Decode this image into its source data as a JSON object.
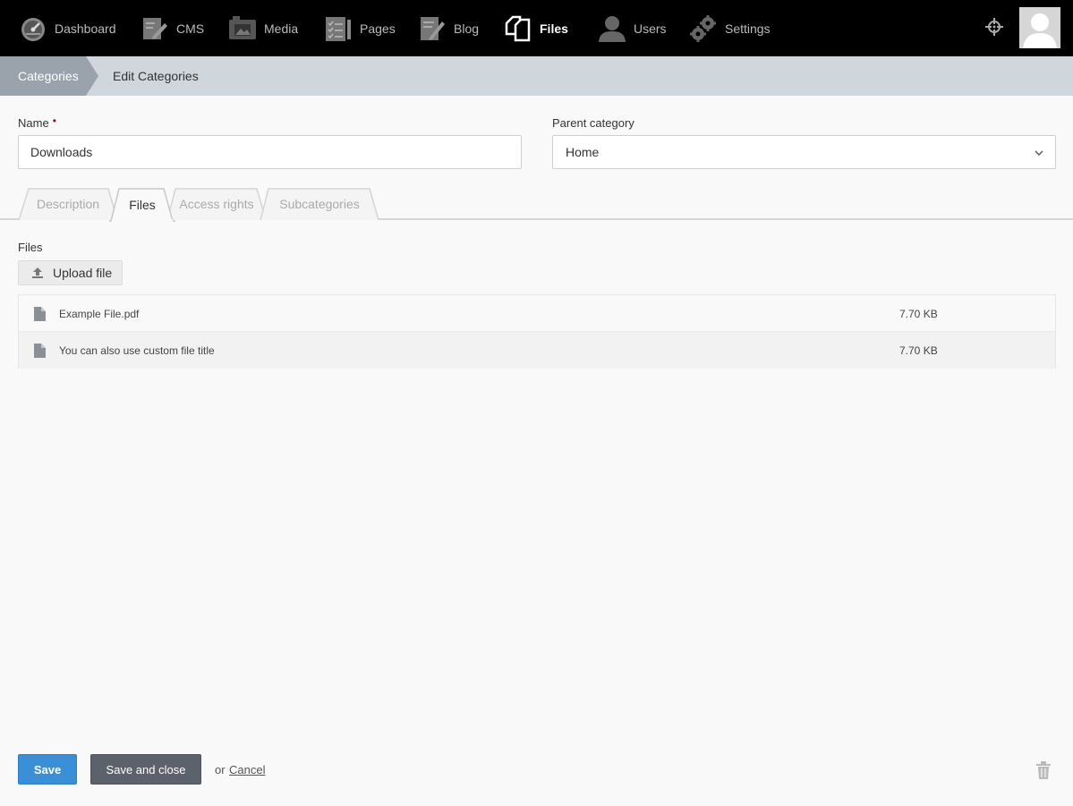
{
  "nav": {
    "items": [
      {
        "label": "Dashboard",
        "icon": "dashboard-gauge-icon"
      },
      {
        "label": "CMS",
        "icon": "cms-edit-icon"
      },
      {
        "label": "Media",
        "icon": "media-camera-icon"
      },
      {
        "label": "Pages",
        "icon": "pages-checklist-icon"
      },
      {
        "label": "Blog",
        "icon": "blog-pencil-icon"
      },
      {
        "label": "Files",
        "icon": "files-copy-icon",
        "active": true
      },
      {
        "label": "Users",
        "icon": "user-icon"
      },
      {
        "label": "Settings",
        "icon": "gears-icon"
      }
    ],
    "right_icons": [
      "crosshair-icon",
      "avatar"
    ]
  },
  "breadcrumb": {
    "first": "Categories",
    "second": "Edit Categories"
  },
  "form": {
    "name_label": "Name",
    "name_required_mark": "•",
    "name_value": "Downloads",
    "parent_label": "Parent category",
    "parent_value": "Home"
  },
  "tabs": [
    {
      "label": "Description",
      "active": false
    },
    {
      "label": "Files",
      "active": true
    },
    {
      "label": "Access rights",
      "active": false
    },
    {
      "label": "Subcategories",
      "active": false
    }
  ],
  "files": {
    "label": "Files",
    "upload_label": "Upload file",
    "rows": [
      {
        "name": "Example File.pdf",
        "size": "7.70 KB"
      },
      {
        "name": "You can also use custom file title",
        "size": "7.70 KB"
      }
    ]
  },
  "footer": {
    "save_label": "Save",
    "save_close_label": "Save and close",
    "or_text": "or",
    "cancel_label": "Cancel"
  },
  "colors": {
    "nav_bg": "#000000",
    "breadcrumb_bg": "#cfd6dc",
    "breadcrumb_active_bg": "#9aa3ab",
    "save_bg": "#3a8fd6",
    "save_close_bg": "#5c626b"
  }
}
